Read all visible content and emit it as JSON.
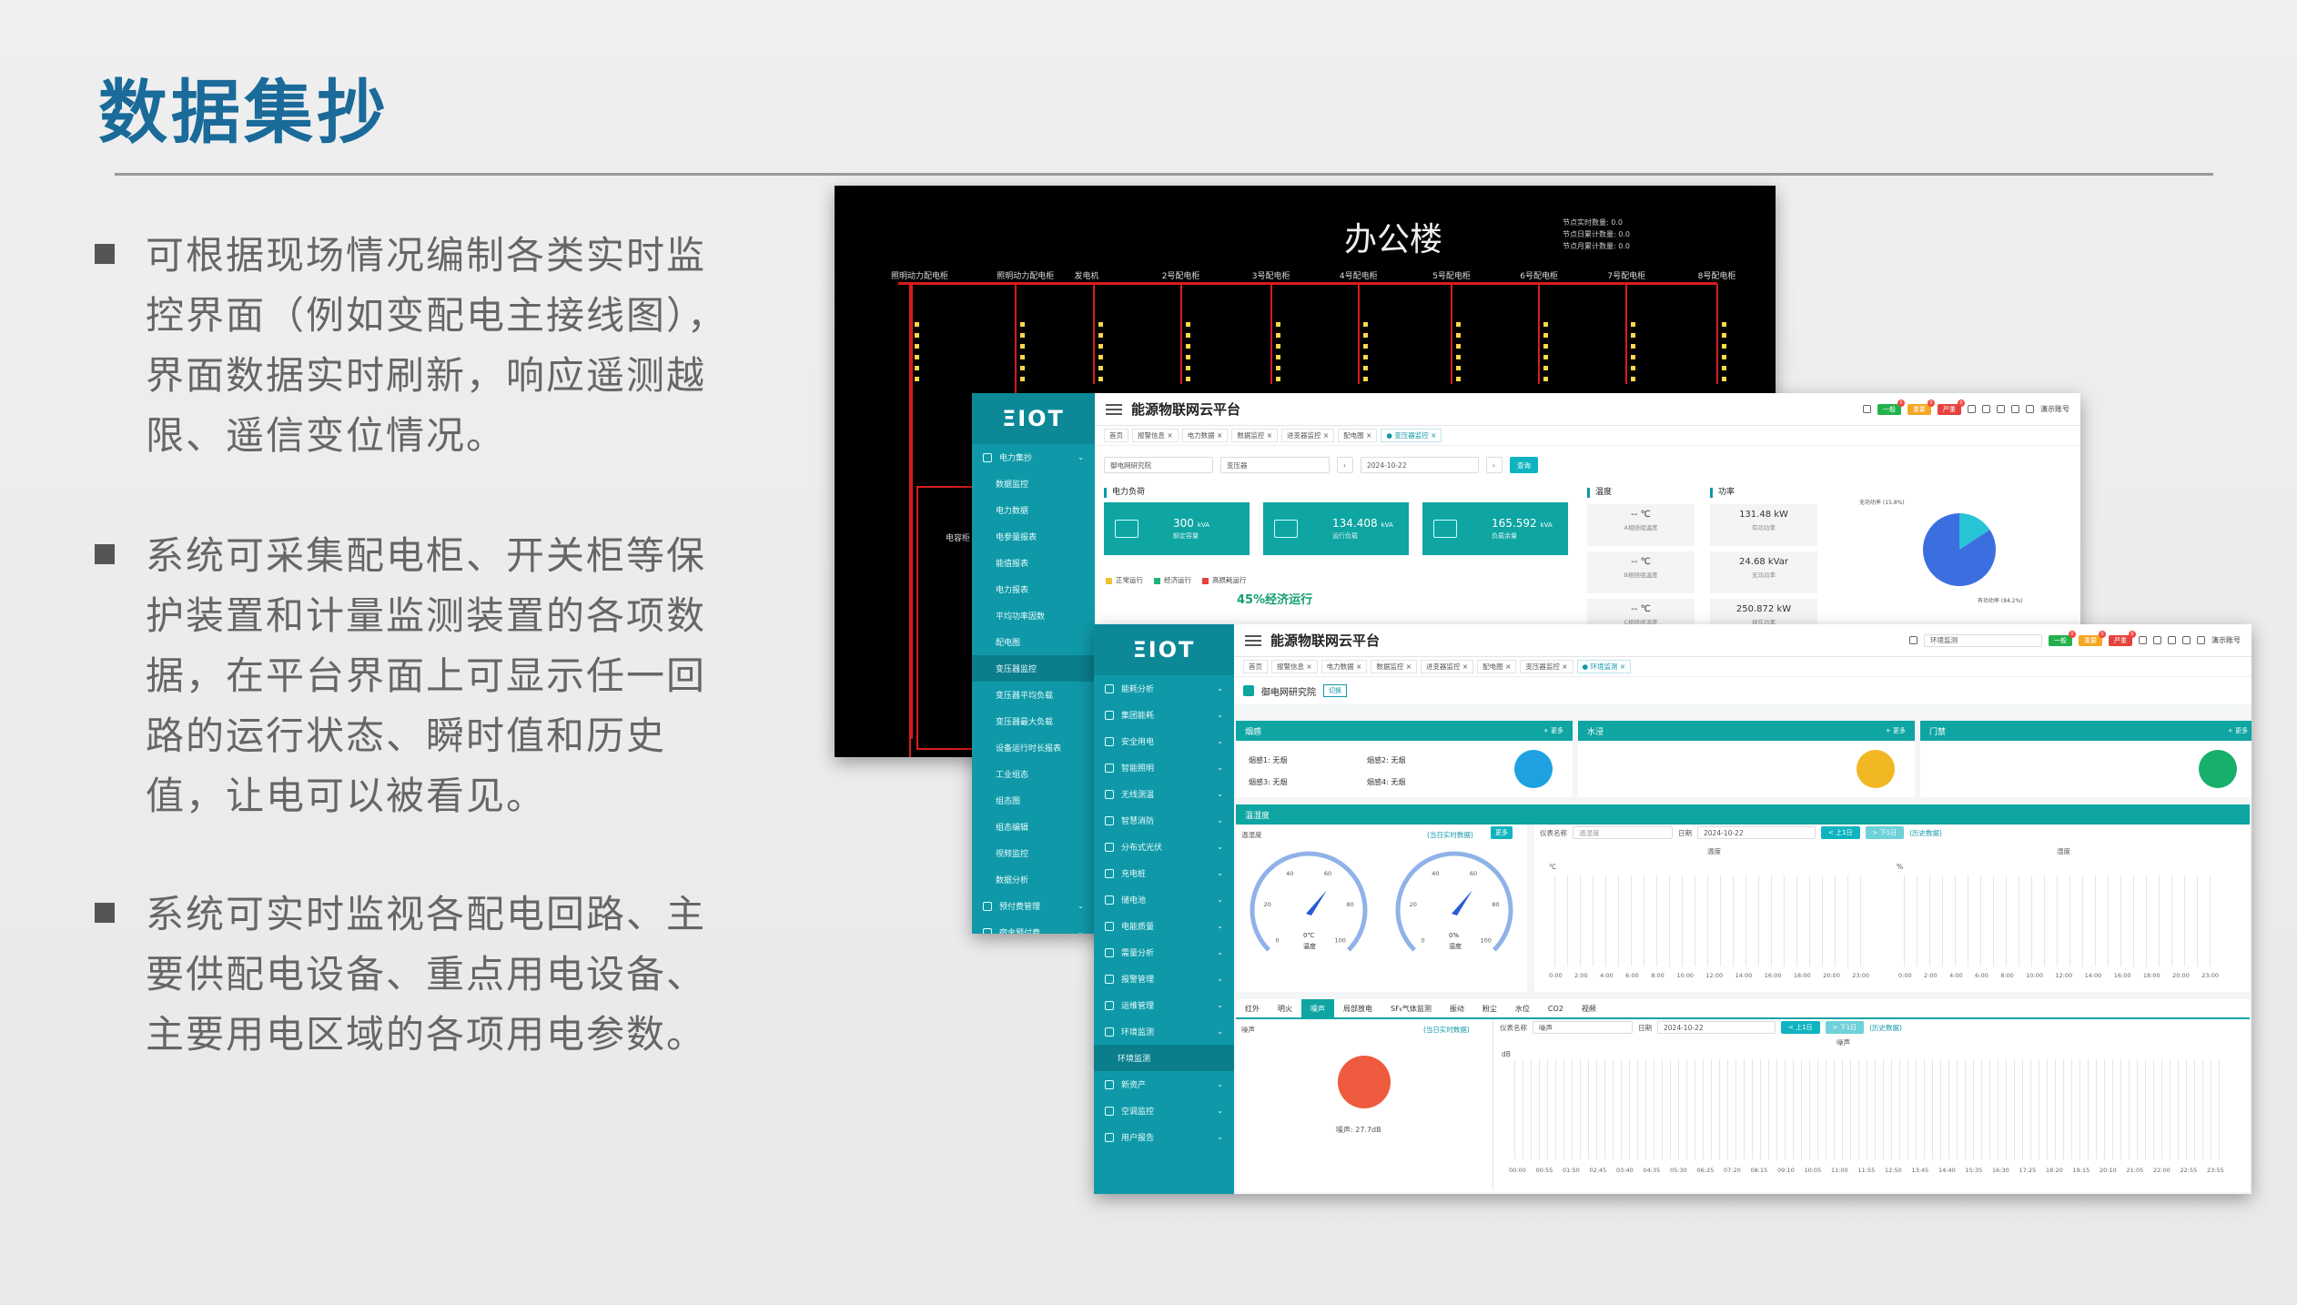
{
  "slide": {
    "title": "数据集抄",
    "bullets": [
      "可根据现场情况编制各类实时监控界面（例如变配电主接线图），界面数据实时刷新，响应遥测越限、遥信变位情况。",
      "系统可采集配电柜、开关柜等保护装置和计量监测装置的各项数据，在平台界面上可显示任一回路的运行状态、瞬时值和历史值，让电可以被看见。",
      "系统可实时监视各配电回路、主要供配电设备、重点用电设备、主要用电区域的各项用电参数。"
    ]
  },
  "scada": {
    "title": "办公楼",
    "notes": [
      "节点实时数量: 0.0",
      "节点日累计数量: 0.0",
      "节点月累计数量: 0.0"
    ],
    "feeders": [
      "照明动力配电柜",
      "照明动力配电柜",
      "发电机",
      "2号配电柜",
      "3号配电柜",
      "4号配电柜",
      "5号配电柜",
      "6号配电柜",
      "7号配电柜",
      "8号配电柜"
    ],
    "side_label": "电容柜",
    "colors": {
      "bus": "#d81c1c",
      "background": "#000000",
      "indicator": "#ffd84a"
    }
  },
  "platform1": {
    "logo": "ΞIOT",
    "title": "能源物联网云平台",
    "badges": [
      {
        "label": "一般",
        "color": "#22b14c"
      },
      {
        "label": "重要",
        "color": "#f5a623"
      },
      {
        "label": "严重",
        "color": "#e5433e"
      }
    ],
    "user": "演示账号",
    "tabs": [
      "首页",
      "报警信息 ×",
      "电力数据 ×",
      "数据监控 ×",
      "进变器监控 ×",
      "配电图 ×",
      "● 变压器监控 ×"
    ],
    "sidebar": [
      {
        "label": "电力集抄",
        "type": "group"
      },
      {
        "label": "数据监控",
        "type": "sub"
      },
      {
        "label": "电力数据",
        "type": "sub"
      },
      {
        "label": "电参量报表",
        "type": "sub"
      },
      {
        "label": "能值报表",
        "type": "sub"
      },
      {
        "label": "电力报表",
        "type": "sub"
      },
      {
        "label": "平均功率因数",
        "type": "sub"
      },
      {
        "label": "配电图",
        "type": "sub"
      },
      {
        "label": "变压器监控",
        "type": "active"
      },
      {
        "label": "变压器平均负载",
        "type": "sub"
      },
      {
        "label": "变压器最大负载",
        "type": "sub"
      },
      {
        "label": "设备运行时长报表",
        "type": "sub"
      },
      {
        "label": "工业组态",
        "type": "sub"
      },
      {
        "label": "组态图",
        "type": "sub"
      },
      {
        "label": "组态编辑",
        "type": "sub"
      },
      {
        "label": "视频监控",
        "type": "sub"
      },
      {
        "label": "数据分析",
        "type": "sub"
      },
      {
        "label": "预付费管理",
        "type": "group"
      },
      {
        "label": "宿舍预付费",
        "type": "group"
      }
    ],
    "filters": {
      "org": "御电网研究院",
      "device": "变压器",
      "date": "2024-10-22",
      "query": "查询"
    },
    "power_load_title": "电力负荷",
    "cards": [
      {
        "value": "300",
        "unit": "kVA",
        "label": "额定容量"
      },
      {
        "value": "134.408",
        "unit": "kVA",
        "label": "运行负载"
      },
      {
        "value": "165.592",
        "unit": "kVA",
        "label": "负载余量"
      }
    ],
    "legend": [
      "正常运行",
      "经济运行",
      "高损耗运行"
    ],
    "econ_text": "45%经济运行",
    "temp_title": "温度",
    "temps": [
      {
        "value": "-- ℃",
        "label": "A相绕组温度"
      },
      {
        "value": "-- ℃",
        "label": "B相绕组温度"
      },
      {
        "value": "-- ℃",
        "label": "C相绕组温度"
      }
    ],
    "power_title": "功率",
    "powers": [
      {
        "value": "131.48  kW",
        "label": "有功功率"
      },
      {
        "value": "24.68  kVar",
        "label": "无功功率"
      },
      {
        "value": "250.872  kW",
        "label": "视在功率"
      }
    ],
    "pie": {
      "labels": [
        "无功功率 (15.8%)",
        "有功功率 (84.2%)"
      ],
      "values": [
        15.8,
        84.2
      ],
      "colors": [
        "#27c3d6",
        "#3b6fe0"
      ]
    }
  },
  "platform2": {
    "logo": "ΞIOT",
    "title": "能源物联网云平台",
    "search_value": "环境监测",
    "badges": [
      {
        "label": "一般",
        "color": "#22b14c"
      },
      {
        "label": "重要",
        "color": "#f5a623"
      },
      {
        "label": "严重",
        "color": "#e5433e"
      }
    ],
    "user": "演示账号",
    "tabs": [
      "首页",
      "报警信息 ×",
      "电力数据 ×",
      "数据监控 ×",
      "进变器监控 ×",
      "配电图 ×",
      "变压器监控 ×",
      "● 环境监测 ×"
    ],
    "sidebar": [
      {
        "label": "能耗分析",
        "type": "group"
      },
      {
        "label": "集团能耗",
        "type": "group"
      },
      {
        "label": "安全用电",
        "type": "group"
      },
      {
        "label": "智能照明",
        "type": "group"
      },
      {
        "label": "无线测温",
        "type": "group"
      },
      {
        "label": "智慧消防",
        "type": "group"
      },
      {
        "label": "分布式光伏",
        "type": "group"
      },
      {
        "label": "充电桩",
        "type": "group"
      },
      {
        "label": "储电池",
        "type": "group"
      },
      {
        "label": "电能质量",
        "type": "group"
      },
      {
        "label": "需量分析",
        "type": "group"
      },
      {
        "label": "报警管理",
        "type": "group"
      },
      {
        "label": "运维管理",
        "type": "group"
      },
      {
        "label": "环境监测",
        "type": "group"
      },
      {
        "label": "环境监测",
        "type": "active"
      },
      {
        "label": "新资产",
        "type": "group"
      },
      {
        "label": "空调监控",
        "type": "group"
      },
      {
        "label": "用户报告",
        "type": "group"
      }
    ],
    "site": "御电网研究院",
    "site_tag": "切换",
    "panels": [
      {
        "title": "烟感",
        "more": "+ 更多",
        "color": "#1da1e0"
      },
      {
        "title": "水浸",
        "more": "+ 更多",
        "color": "#f2b824"
      },
      {
        "title": "门禁",
        "more": "+ 更多",
        "color": "#17b06a"
      }
    ],
    "smoke_items": [
      "烟感1: 无烟",
      "烟感2: 无烟",
      "烟感3: 无烟",
      "烟感4: 无烟"
    ],
    "humidity_header": "温湿度",
    "th": {
      "title": "温湿度",
      "realtime_link": "(当日实时数据)",
      "more": "更多",
      "meter_label": "仪表名称",
      "meter_value": "温湿度",
      "date_label": "日期",
      "date": "2024-10-22",
      "prev": "< 上1日",
      "next": "> 下1日",
      "history": "(历史数据)",
      "gauge_temp": {
        "value": "0℃",
        "label": "温度",
        "ticks": [
          "0",
          "20",
          "40",
          "60",
          "80",
          "100"
        ]
      },
      "gauge_hum": {
        "value": "0%",
        "label": "湿度",
        "ticks": [
          "0",
          "20",
          "40",
          "60",
          "80",
          "100"
        ]
      },
      "chart_temp_title": "温度",
      "chart_hum_title": "湿度",
      "unit_temp": "℃",
      "unit_hum": "%",
      "x_ticks": [
        "0:00",
        "2:00",
        "4:00",
        "6:00",
        "8:00",
        "10:00",
        "12:00",
        "14:00",
        "16:00",
        "18:00",
        "20:00",
        "23:00"
      ]
    },
    "env_tabs": [
      "红外",
      "明火",
      "噪声",
      "局部放电",
      "SF₆气体监测",
      "振动",
      "粉尘",
      "水位",
      "CO2",
      "视频"
    ],
    "noise": {
      "title": "噪声",
      "realtime_link": "(当日实时数据)",
      "meter_label": "仪表名称",
      "meter_value": "噪声",
      "date_label": "日期",
      "date": "2024-10-22",
      "prev": "< 上1日",
      "next": "> 下1日",
      "history": "(历史数据)",
      "reading": "噪声: 27.7dB",
      "chart_title": "噪声",
      "unit": "dB",
      "x_ticks": [
        "00:00",
        "00:55",
        "01:50",
        "02:45",
        "03:40",
        "04:35",
        "05:30",
        "06:25",
        "07:20",
        "08:15",
        "09:10",
        "10:05",
        "11:00",
        "11:55",
        "12:50",
        "13:45",
        "14:40",
        "15:35",
        "16:30",
        "17:25",
        "18:20",
        "19:15",
        "20:10",
        "21:05",
        "22:00",
        "22:55",
        "23:55"
      ]
    }
  }
}
